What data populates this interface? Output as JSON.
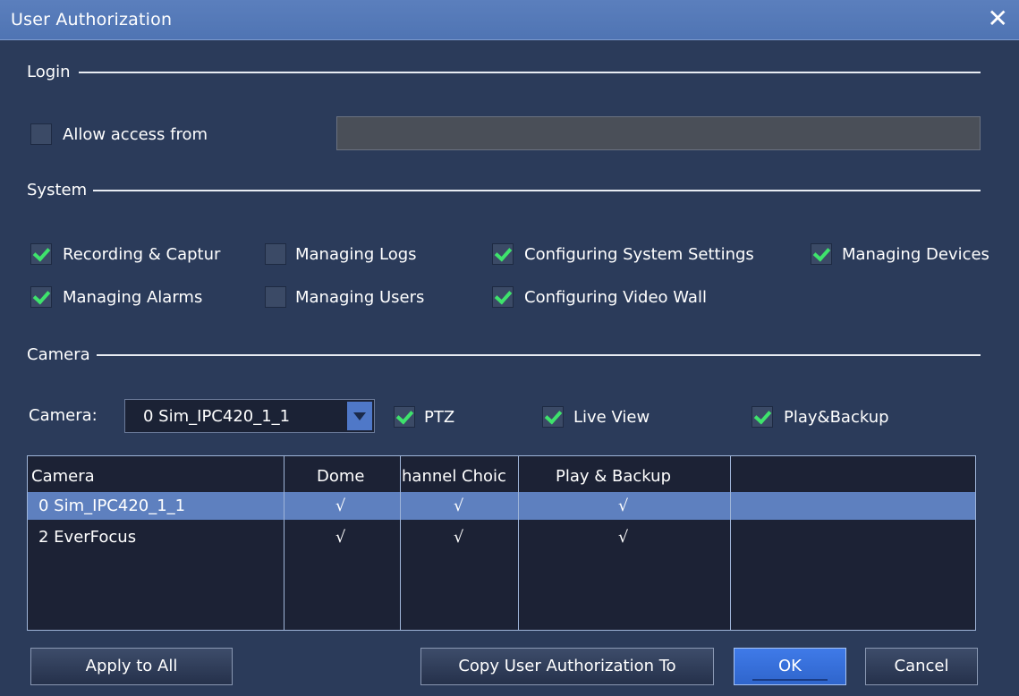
{
  "window": {
    "title": "User Authorization",
    "close_glyph": "✕"
  },
  "login": {
    "section_label": "Login",
    "allow_access_label": "Allow access from",
    "allow_access_checked": false,
    "address_value": ""
  },
  "system": {
    "section_label": "System",
    "options": [
      {
        "label": "Recording & Captur",
        "checked": true
      },
      {
        "label": "Managing Logs",
        "checked": false
      },
      {
        "label": "Configuring System Settings",
        "checked": true
      },
      {
        "label": "Managing Devices",
        "checked": true
      },
      {
        "label": "Managing Alarms",
        "checked": true
      },
      {
        "label": "Managing Users",
        "checked": false
      },
      {
        "label": "Configuring Video Wall",
        "checked": true
      }
    ]
  },
  "camera": {
    "section_label": "Camera",
    "select_label": "Camera:",
    "selected_camera": "0 Sim_IPC420_1_1",
    "options": [
      {
        "label": "PTZ",
        "checked": true
      },
      {
        "label": "Live View",
        "checked": true
      },
      {
        "label": "Play&Backup",
        "checked": true
      }
    ]
  },
  "table": {
    "headers": [
      "Camera",
      "Dome",
      "hannel Choic",
      "Play & Backup"
    ],
    "rows": [
      {
        "camera": "0 Sim_IPC420_1_1",
        "dome": "√",
        "channel": "√",
        "play": "√",
        "selected": true
      },
      {
        "camera": "2 EverFocus",
        "dome": "√",
        "channel": "√",
        "play": "√",
        "selected": false
      }
    ]
  },
  "buttons": {
    "apply_all": "Apply to All",
    "copy": "Copy User Authorization To",
    "ok": "OK",
    "cancel": "Cancel"
  },
  "icons": {
    "close": "close-icon",
    "checkbox": "checkbox",
    "dropdown": "chevron-down-icon"
  },
  "colors": {
    "titlebar": "#5b7fbd",
    "background": "#2b3b5a",
    "check": "#3ee36c",
    "selected_row": "#5e80bf",
    "ok_button": "#3f7ae8"
  }
}
